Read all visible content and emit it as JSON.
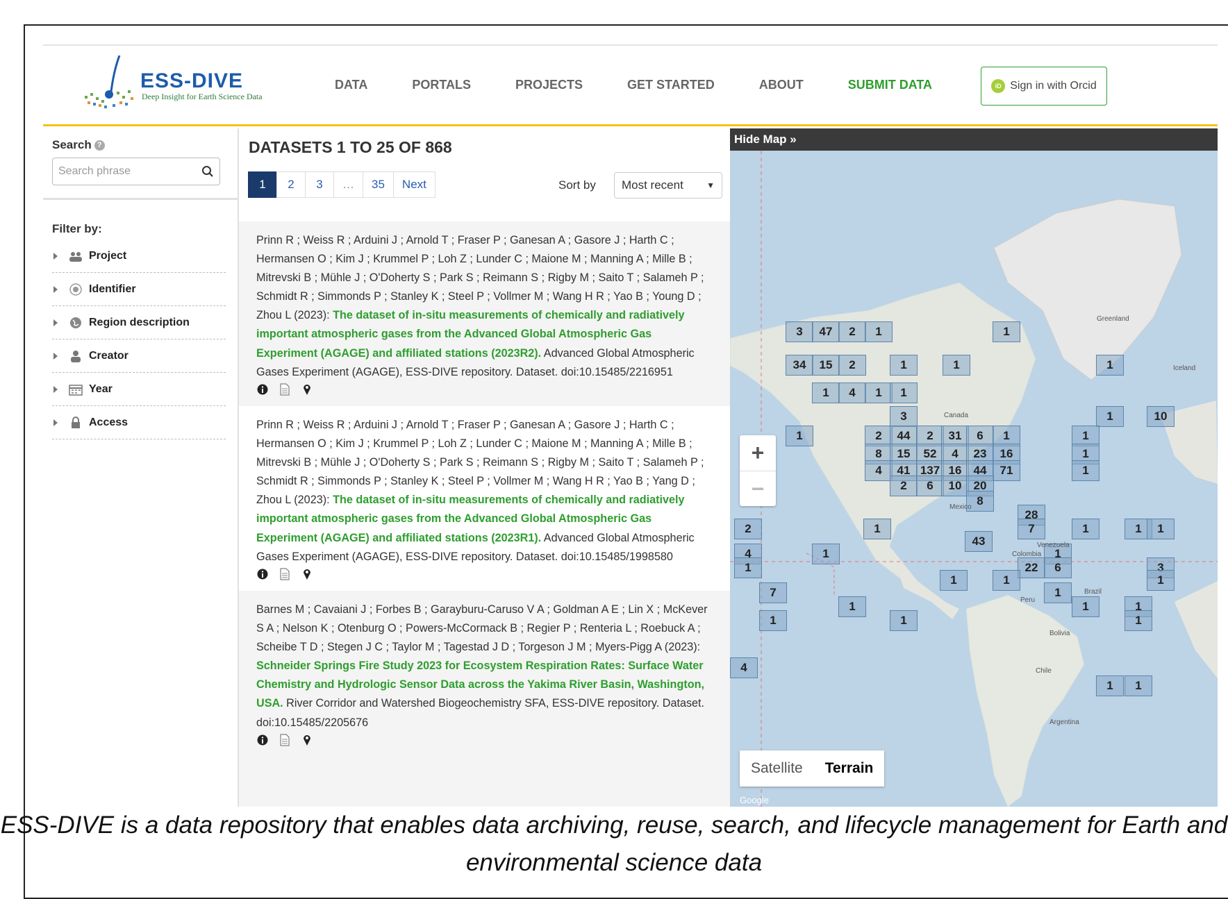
{
  "header": {
    "logo_name": "ESS-DIVE",
    "logo_tagline": "Deep Insight for Earth Science Data",
    "nav": [
      "DATA",
      "PORTALS",
      "PROJECTS",
      "GET STARTED",
      "ABOUT",
      "SUBMIT DATA"
    ],
    "signin_label": "Sign in with Orcid",
    "orcid_badge": "iD"
  },
  "sidebar": {
    "search_label": "Search",
    "search_placeholder": "Search phrase",
    "filter_label": "Filter by:",
    "filters": [
      "Project",
      "Identifier",
      "Region description",
      "Creator",
      "Year",
      "Access"
    ]
  },
  "results": {
    "title": "DATASETS 1 TO 25 OF 868",
    "pages": [
      "1",
      "2",
      "3",
      "…",
      "35",
      "Next"
    ],
    "sort_label": "Sort by",
    "sort_value": "Most recent",
    "records": [
      {
        "authors": "Prinn R ; Weiss R ; Arduini J ; Arnold T ; Fraser P ; Ganesan A ; Gasore J ; Harth C ; Hermansen O ; Kim J ; Krummel P ; Loh Z ; Lunder C ; Maione M ; Manning A ; Mille B ; Mitrevski B ; Mühle J ; O'Doherty S ; Park S ; Reimann S ; Rigby M ; Saito T ; Salameh P ; Schmidt R ; Simmonds P ; Stanley K ; Steel P ; Vollmer M ; Wang H R ; Yao B ; Young D ; Zhou L (2023): ",
        "title": "The dataset of in-situ measurements of chemically and radiatively important atmospheric gases from the Advanced Global Atmospheric Gas Experiment (AGAGE) and affiliated stations (2023R2).",
        "rest": " Advanced Global Atmospheric Gases Experiment (AGAGE), ESS-DIVE repository. Dataset. doi:10.15485/2216951"
      },
      {
        "authors": "Prinn R ; Weiss R ; Arduini J ; Arnold T ; Fraser P ; Ganesan A ; Gasore J ; Harth C ; Hermansen O ; Kim J ; Krummel P ; Loh Z ; Lunder C ; Maione M ; Manning A ; Mille B ; Mitrevski B ; Mühle J ; O'Doherty S ; Park S ; Reimann S ; Rigby M ; Saito T ; Salameh P ; Schmidt R ; Simmonds P ; Stanley K ; Steel P ; Vollmer M ; Wang H R ; Yao B ; Yang D ; Zhou L (2023): ",
        "title": "The dataset of in-situ measurements of chemically and radiatively important atmospheric gases from the Advanced Global Atmospheric Gas Experiment (AGAGE) and affiliated stations (2023R1).",
        "rest": " Advanced Global Atmospheric Gases Experiment (AGAGE), ESS-DIVE repository. Dataset. doi:10.15485/1998580"
      },
      {
        "authors": "Barnes M ; Cavaiani J ; Forbes B ; Garayburu-Caruso V A ; Goldman A E ; Lin X ; McKever S A ; Nelson K ; Otenburg O ; Powers-McCormack B ; Regier P ; Renteria L ; Roebuck A ; Scheibe T D ; Stegen J C ; Taylor M ; Tagestad J D ; Torgeson J M ; Myers-Pigg A (2023): ",
        "title": "Schneider Springs Fire Study 2023 for Ecosystem Respiration Rates: Surface Water Chemistry and Hydrologic Sensor Data across the Yakima River Basin, Washington, USA.",
        "rest": " River Corridor and Watershed Biogeochemistry SFA, ESS-DIVE repository. Dataset. doi:10.15485/2205676"
      }
    ]
  },
  "map": {
    "hide_label": "Hide Map  »",
    "zoom_in": "+",
    "zoom_out": "−",
    "types": [
      "Satellite",
      "Terrain"
    ],
    "active_type": "Terrain",
    "place_labels": [
      "Greenland",
      "Iceland",
      "Canada",
      "Mexico",
      "Venezuela",
      "Colombia",
      "Peru",
      "Brazil",
      "Bolivia",
      "Chile",
      "Argentina",
      "Google"
    ],
    "counts": [
      "3",
      "47",
      "2",
      "1",
      "1",
      "34",
      "15",
      "2",
      "1",
      "1",
      "1",
      "1",
      "4",
      "1",
      "1",
      "3",
      "1",
      "10",
      "1",
      "2",
      "44",
      "2",
      "31",
      "6",
      "1",
      "1",
      "8",
      "15",
      "52",
      "4",
      "23",
      "16",
      "1",
      "4",
      "41",
      "137",
      "16",
      "44",
      "71",
      "1",
      "2",
      "6",
      "10",
      "20",
      "8",
      "28",
      "7",
      "2",
      "1",
      "1",
      "1",
      "1",
      "43",
      "4",
      "1",
      "1",
      "22",
      "6",
      "3",
      "1",
      "1",
      "1",
      "1",
      "7",
      "1",
      "1",
      "1",
      "1",
      "1",
      "1",
      "1",
      "4",
      "1",
      "1"
    ]
  },
  "caption": "ESS-DIVE is a data repository that enables data archiving, reuse, search, and lifecycle management for Earth and environmental science data",
  "colors": {
    "accent_green": "#2e9e2e",
    "brand_blue": "#1d5cab",
    "header_rule": "#f0c419",
    "map_water": "#bdd3e6"
  }
}
